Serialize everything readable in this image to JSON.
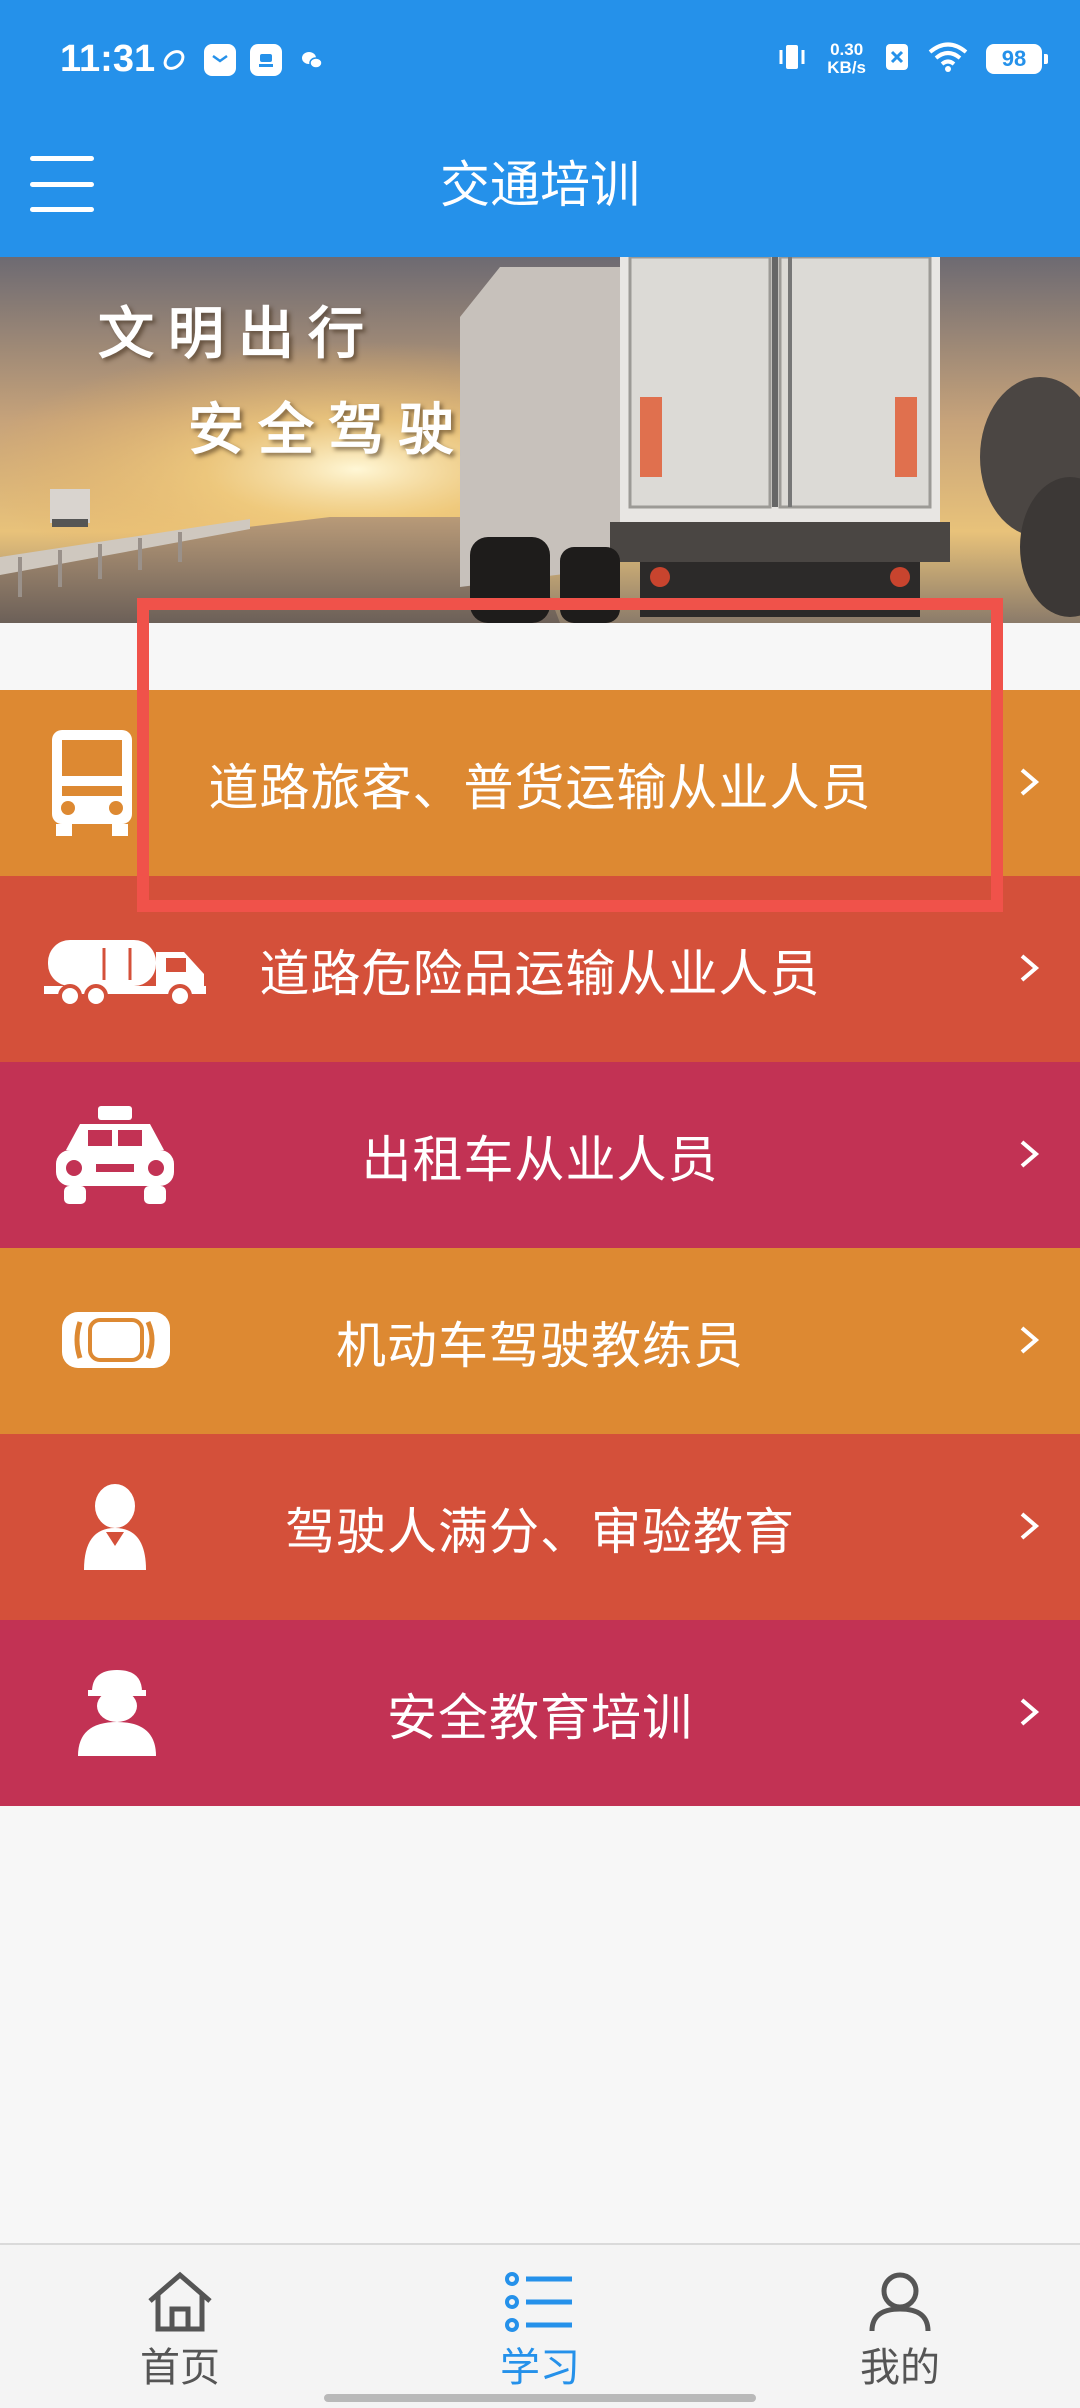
{
  "status_bar": {
    "time": "11:31",
    "net_speed_value": "0.30",
    "net_speed_unit": "KB/s",
    "battery": "98"
  },
  "header": {
    "title": "交通培训",
    "background_color": "#2591ea"
  },
  "banner": {
    "line1": "文明出行",
    "line2": "安全驾驶"
  },
  "menu": {
    "items": [
      {
        "label": "道路旅客、普货运输从业人员",
        "icon": "truck-front-icon",
        "color": "#dd8932"
      },
      {
        "label": "道路危险品运输从业人员",
        "icon": "tanker-truck-icon",
        "color": "#d4503a"
      },
      {
        "label": "出租车从业人员",
        "icon": "taxi-icon",
        "color": "#c23254"
      },
      {
        "label": "机动车驾驶教练员",
        "icon": "car-top-view-icon",
        "color": "#dd8932"
      },
      {
        "label": "驾驶人满分、审验教育",
        "icon": "person-icon",
        "color": "#d4503a"
      },
      {
        "label": "安全教育培训",
        "icon": "worker-helmet-icon",
        "color": "#c23254"
      }
    ]
  },
  "bottom_nav": {
    "items": [
      {
        "label": "首页",
        "icon": "home-icon",
        "active": false
      },
      {
        "label": "学习",
        "icon": "list-icon",
        "active": true
      },
      {
        "label": "我的",
        "icon": "user-icon",
        "active": false
      }
    ],
    "active_color": "#2591ea",
    "inactive_color": "#555555"
  }
}
